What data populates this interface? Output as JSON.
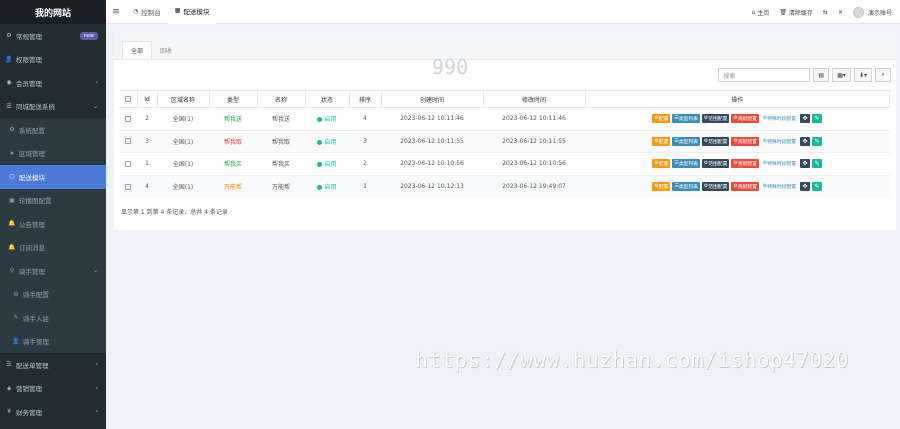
{
  "sidebar": {
    "logo": "我的网站",
    "items": [
      {
        "icon": "cogs-icon",
        "label": "常规管理",
        "badge": "new",
        "chevron": ""
      },
      {
        "icon": "user-icon",
        "label": "权限管理",
        "badge": "",
        "chevron": ""
      },
      {
        "icon": "user-circle-icon",
        "label": "会员管理",
        "badge": "",
        "chevron": "‹"
      },
      {
        "icon": "list-icon",
        "label": "同城配送系统",
        "badge": "",
        "chevron": "⌄"
      }
    ],
    "subitems": [
      {
        "icon": "cogs-icon",
        "label": "系统配置",
        "chevron": ""
      },
      {
        "icon": "send-icon",
        "label": "区域管理",
        "chevron": ""
      },
      {
        "icon": "circle-icon",
        "label": "配送模块",
        "chevron": "",
        "active": true
      },
      {
        "icon": "image-icon",
        "label": "轮播图配置",
        "chevron": ""
      },
      {
        "icon": "bell-icon",
        "label": "公告管理",
        "chevron": ""
      },
      {
        "icon": "bell-icon",
        "label": "订阅消息",
        "chevron": ""
      },
      {
        "icon": "bicycle-icon",
        "label": "骑手管理",
        "chevron": "⌄"
      }
    ],
    "subitems2": [
      {
        "icon": "gear-icon",
        "label": "骑手配置"
      },
      {
        "icon": "edit-icon",
        "label": "骑手入驻"
      },
      {
        "icon": "user-icon",
        "label": "骑手管理"
      }
    ],
    "bottom": [
      {
        "icon": "list-icon",
        "label": "配送单管理",
        "chevron": "‹"
      },
      {
        "icon": "chart-icon",
        "label": "营销管理",
        "chevron": "‹"
      },
      {
        "icon": "money-icon",
        "label": "财务管理",
        "chevron": "‹"
      }
    ]
  },
  "topbar": {
    "tabs": [
      {
        "icon": "dashboard-icon",
        "label": "控制台"
      },
      {
        "icon": "grid-icon",
        "label": "配送模块"
      }
    ],
    "right": {
      "home": "主页",
      "clear_cache": "清除缓存",
      "username": "演示账号"
    }
  },
  "panel": {
    "tabs": [
      "全部",
      "回收"
    ],
    "search_placeholder": "搜索",
    "columns": [
      "Id",
      "区域名称",
      "类型",
      "名称",
      "状态",
      "排序",
      "创建时间",
      "修改时间",
      "操作"
    ],
    "rows": [
      {
        "id": "2",
        "area": "全国(1)",
        "type": "帮我送",
        "type_color": "green",
        "name": "帮我送",
        "status": "启用",
        "sort": "4",
        "created": "2023-06-12 10:11:46",
        "modified": "2023-06-12 10:11:46"
      },
      {
        "id": "3",
        "area": "全国(1)",
        "type": "帮我取",
        "type_color": "red",
        "name": "帮我取",
        "status": "启用",
        "sort": "3",
        "created": "2023-06-12 10:11:55",
        "modified": "2023-06-12 10:11:55"
      },
      {
        "id": "1",
        "area": "全国(1)",
        "type": "帮我买",
        "type_color": "green",
        "name": "帮我买",
        "status": "启用",
        "sort": "2",
        "created": "2023-06-12 10:10:56",
        "modified": "2023-06-12 10:10:56"
      },
      {
        "id": "4",
        "area": "全国(1)",
        "type": "万能帮",
        "type_color": "orange",
        "name": "万能帮",
        "status": "启用",
        "sort": "1",
        "created": "2023-06-12 10:12:13",
        "modified": "2023-06-12 19:49:07"
      }
    ],
    "actions": [
      "配置",
      "类型列表",
      "范围配置",
      "贡献配置",
      "特殊时段配置"
    ],
    "summary": "显示第 1 到第 4 条记录，总共 4 条记录"
  },
  "watermarks": {
    "top": "990",
    "bottom": "https://www.huzhan.com/ishop47020"
  }
}
